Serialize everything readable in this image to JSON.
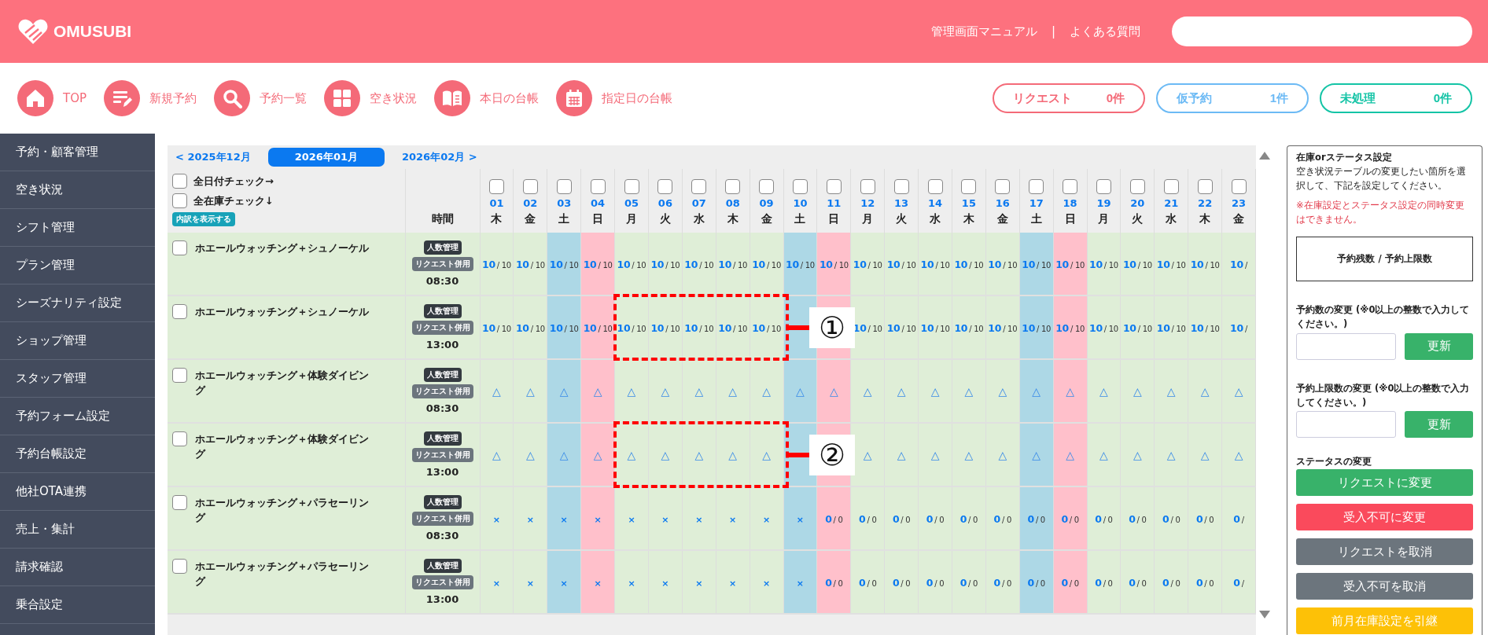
{
  "header": {
    "brand": "OMUSUBI",
    "links": [
      {
        "label": "管理画面マニュアル"
      },
      {
        "label": "よくある質問"
      }
    ],
    "link_separator": "|"
  },
  "nav": [
    {
      "label": "TOP"
    },
    {
      "label": "新規予約"
    },
    {
      "label": "予約一覧"
    },
    {
      "label": "空き状況"
    },
    {
      "label": "本日の台帳"
    },
    {
      "label": "指定日の台帳"
    }
  ],
  "counters": [
    {
      "label": "リクエスト",
      "count": "0件",
      "kind": "request"
    },
    {
      "label": "仮予約",
      "count": "1件",
      "kind": "provisional"
    },
    {
      "label": "未処理",
      "count": "0件",
      "kind": "unprocessed"
    }
  ],
  "sidebar": {
    "items": [
      {
        "label": "予約・顧客管理",
        "selected": false
      },
      {
        "label": "空き状況",
        "selected": false
      },
      {
        "label": "シフト管理",
        "selected": false
      },
      {
        "label": "プラン管理",
        "selected": false
      },
      {
        "label": "シーズナリティ設定",
        "selected": false
      },
      {
        "label": "ショップ管理",
        "selected": false
      },
      {
        "label": "スタッフ管理",
        "selected": false
      },
      {
        "label": "予約フォーム設定",
        "selected": false
      },
      {
        "label": "予約台帳設定",
        "selected": false
      },
      {
        "label": "他社OTA連携",
        "selected": false
      },
      {
        "label": "売上・集計",
        "selected": false
      },
      {
        "label": "請求確認",
        "selected": false
      },
      {
        "label": "乗合設定",
        "selected": false
      }
    ]
  },
  "availability": {
    "months": [
      {
        "label": "< 2025年12月",
        "selected": false
      },
      {
        "label": "2026年01月",
        "selected": true
      },
      {
        "label": "2026年02月 >",
        "selected": false
      }
    ],
    "check_all_dates": {
      "label": "全日付チェック→",
      "checked": false
    },
    "check_all_stock": {
      "label": "全在庫チェック↓",
      "checked": false
    },
    "breakdown_button": "内訳を表示する",
    "time_heading": "時間",
    "days": [
      {
        "date": "01",
        "weekday": "木",
        "kind": "weekday",
        "checked": false
      },
      {
        "date": "02",
        "weekday": "金",
        "kind": "weekday",
        "checked": false
      },
      {
        "date": "03",
        "weekday": "土",
        "kind": "saturday",
        "checked": false
      },
      {
        "date": "04",
        "weekday": "日",
        "kind": "sunday",
        "checked": false
      },
      {
        "date": "05",
        "weekday": "月",
        "kind": "weekday",
        "checked": false
      },
      {
        "date": "06",
        "weekday": "火",
        "kind": "weekday",
        "checked": false
      },
      {
        "date": "07",
        "weekday": "水",
        "kind": "weekday",
        "checked": false
      },
      {
        "date": "08",
        "weekday": "木",
        "kind": "weekday",
        "checked": false
      },
      {
        "date": "09",
        "weekday": "金",
        "kind": "weekday",
        "checked": false
      },
      {
        "date": "10",
        "weekday": "土",
        "kind": "saturday",
        "checked": false
      },
      {
        "date": "11",
        "weekday": "日",
        "kind": "sunday",
        "checked": false
      },
      {
        "date": "12",
        "weekday": "月",
        "kind": "weekday",
        "checked": false
      },
      {
        "date": "13",
        "weekday": "火",
        "kind": "weekday",
        "checked": false
      },
      {
        "date": "14",
        "weekday": "水",
        "kind": "weekday",
        "checked": false
      },
      {
        "date": "15",
        "weekday": "木",
        "kind": "weekday",
        "checked": false
      },
      {
        "date": "16",
        "weekday": "金",
        "kind": "weekday",
        "checked": false
      },
      {
        "date": "17",
        "weekday": "土",
        "kind": "saturday",
        "checked": false
      },
      {
        "date": "18",
        "weekday": "日",
        "kind": "sunday",
        "checked": false
      },
      {
        "date": "19",
        "weekday": "月",
        "kind": "weekday",
        "checked": false
      },
      {
        "date": "20",
        "weekday": "火",
        "kind": "weekday",
        "checked": false
      },
      {
        "date": "21",
        "weekday": "水",
        "kind": "weekday",
        "checked": false
      },
      {
        "date": "22",
        "weekday": "木",
        "kind": "weekday",
        "checked": false
      },
      {
        "date": "23",
        "weekday": "金",
        "kind": "weekday",
        "checked": false
      }
    ],
    "rows": [
      {
        "name": "ホエールウォッチング＋シュノーケル",
        "checked": false,
        "tags": [
          {
            "label": "人数管理",
            "kind": "dark"
          },
          {
            "label": "リクエスト併用",
            "kind": "grey"
          }
        ],
        "time": "08:30",
        "cells": [
          {
            "kind": "count",
            "value": "10",
            "rest": "/ 10"
          },
          {
            "kind": "count",
            "value": "10",
            "rest": "/ 10"
          },
          {
            "kind": "count",
            "value": "10",
            "rest": "/ 10"
          },
          {
            "kind": "count",
            "value": "10",
            "rest": "/ 10"
          },
          {
            "kind": "count",
            "value": "10",
            "rest": "/ 10"
          },
          {
            "kind": "count",
            "value": "10",
            "rest": "/ 10"
          },
          {
            "kind": "count",
            "value": "10",
            "rest": "/ 10"
          },
          {
            "kind": "count",
            "value": "10",
            "rest": "/ 10"
          },
          {
            "kind": "count",
            "value": "10",
            "rest": "/ 10"
          },
          {
            "kind": "count",
            "value": "10",
            "rest": "/ 10"
          },
          {
            "kind": "count",
            "value": "10",
            "rest": "/ 10"
          },
          {
            "kind": "count",
            "value": "10",
            "rest": "/ 10"
          },
          {
            "kind": "count",
            "value": "10",
            "rest": "/ 10"
          },
          {
            "kind": "count",
            "value": "10",
            "rest": "/ 10"
          },
          {
            "kind": "count",
            "value": "10",
            "rest": "/ 10"
          },
          {
            "kind": "count",
            "value": "10",
            "rest": "/ 10"
          },
          {
            "kind": "count",
            "value": "10",
            "rest": "/ 10"
          },
          {
            "kind": "count",
            "value": "10",
            "rest": "/ 10"
          },
          {
            "kind": "count",
            "value": "10",
            "rest": "/ 10"
          },
          {
            "kind": "count",
            "value": "10",
            "rest": "/ 10"
          },
          {
            "kind": "count",
            "value": "10",
            "rest": "/ 10"
          },
          {
            "kind": "count",
            "value": "10",
            "rest": "/ 10"
          },
          {
            "kind": "count",
            "value": "10",
            "rest": "/"
          }
        ]
      },
      {
        "name": "ホエールウォッチング＋シュノーケル",
        "checked": false,
        "tags": [
          {
            "label": "人数管理",
            "kind": "dark"
          },
          {
            "label": "リクエスト併用",
            "kind": "grey"
          }
        ],
        "time": "13:00",
        "cells": [
          {
            "kind": "count",
            "value": "10",
            "rest": "/ 10"
          },
          {
            "kind": "count",
            "value": "10",
            "rest": "/ 10"
          },
          {
            "kind": "count",
            "value": "10",
            "rest": "/ 10"
          },
          {
            "kind": "count",
            "value": "10",
            "rest": "/ 10"
          },
          {
            "kind": "count",
            "value": "10",
            "rest": "/ 10",
            "framed": true
          },
          {
            "kind": "count",
            "value": "10",
            "rest": "/ 10",
            "framed": true
          },
          {
            "kind": "count",
            "value": "10",
            "rest": "/ 10",
            "framed": true
          },
          {
            "kind": "count",
            "value": "10",
            "rest": "/ 10",
            "framed": true
          },
          {
            "kind": "count",
            "value": "10",
            "rest": "/ 10",
            "framed": true
          },
          {
            "kind": "covered"
          },
          {
            "kind": "covered"
          },
          {
            "kind": "count",
            "value": "10",
            "rest": "/ 10"
          },
          {
            "kind": "count",
            "value": "10",
            "rest": "/ 10"
          },
          {
            "kind": "count",
            "value": "10",
            "rest": "/ 10"
          },
          {
            "kind": "count",
            "value": "10",
            "rest": "/ 10"
          },
          {
            "kind": "count",
            "value": "10",
            "rest": "/ 10"
          },
          {
            "kind": "count",
            "value": "10",
            "rest": "/ 10"
          },
          {
            "kind": "count",
            "value": "10",
            "rest": "/ 10"
          },
          {
            "kind": "count",
            "value": "10",
            "rest": "/ 10"
          },
          {
            "kind": "count",
            "value": "10",
            "rest": "/ 10"
          },
          {
            "kind": "count",
            "value": "10",
            "rest": "/ 10"
          },
          {
            "kind": "count",
            "value": "10",
            "rest": "/ 10"
          },
          {
            "kind": "count",
            "value": "10",
            "rest": "/"
          }
        ]
      },
      {
        "name": "ホエールウォッチング＋体験ダイビング",
        "checked": false,
        "tags": [
          {
            "label": "人数管理",
            "kind": "dark"
          },
          {
            "label": "リクエスト併用",
            "kind": "grey"
          }
        ],
        "time": "08:30",
        "cells": [
          {
            "kind": "mark",
            "text": "△"
          },
          {
            "kind": "mark",
            "text": "△"
          },
          {
            "kind": "mark",
            "text": "△"
          },
          {
            "kind": "mark",
            "text": "△"
          },
          {
            "kind": "mark",
            "text": "△"
          },
          {
            "kind": "mark",
            "text": "△"
          },
          {
            "kind": "mark",
            "text": "△"
          },
          {
            "kind": "mark",
            "text": "△"
          },
          {
            "kind": "mark",
            "text": "△"
          },
          {
            "kind": "mark",
            "text": "△"
          },
          {
            "kind": "mark",
            "text": "△"
          },
          {
            "kind": "mark",
            "text": "△"
          },
          {
            "kind": "mark",
            "text": "△"
          },
          {
            "kind": "mark",
            "text": "△"
          },
          {
            "kind": "mark",
            "text": "△"
          },
          {
            "kind": "mark",
            "text": "△"
          },
          {
            "kind": "mark",
            "text": "△"
          },
          {
            "kind": "mark",
            "text": "△"
          },
          {
            "kind": "mark",
            "text": "△"
          },
          {
            "kind": "mark",
            "text": "△"
          },
          {
            "kind": "mark",
            "text": "△"
          },
          {
            "kind": "mark",
            "text": "△"
          },
          {
            "kind": "mark",
            "text": "△"
          }
        ]
      },
      {
        "name": "ホエールウォッチング＋体験ダイビング",
        "checked": false,
        "tags": [
          {
            "label": "人数管理",
            "kind": "dark"
          },
          {
            "label": "リクエスト併用",
            "kind": "grey"
          }
        ],
        "time": "13:00",
        "cells": [
          {
            "kind": "mark",
            "text": "△"
          },
          {
            "kind": "mark",
            "text": "△"
          },
          {
            "kind": "mark",
            "text": "△"
          },
          {
            "kind": "mark",
            "text": "△"
          },
          {
            "kind": "mark",
            "text": "△",
            "framed": true
          },
          {
            "kind": "mark",
            "text": "△",
            "framed": true
          },
          {
            "kind": "mark",
            "text": "△",
            "framed": true
          },
          {
            "kind": "mark",
            "text": "△",
            "framed": true
          },
          {
            "kind": "mark",
            "text": "△",
            "framed": true
          },
          {
            "kind": "covered"
          },
          {
            "kind": "covered"
          },
          {
            "kind": "mark",
            "text": "△"
          },
          {
            "kind": "mark",
            "text": "△"
          },
          {
            "kind": "mark",
            "text": "△"
          },
          {
            "kind": "mark",
            "text": "△"
          },
          {
            "kind": "mark",
            "text": "△"
          },
          {
            "kind": "mark",
            "text": "△"
          },
          {
            "kind": "mark",
            "text": "△"
          },
          {
            "kind": "mark",
            "text": "△"
          },
          {
            "kind": "mark",
            "text": "△"
          },
          {
            "kind": "mark",
            "text": "△"
          },
          {
            "kind": "mark",
            "text": "△"
          },
          {
            "kind": "mark",
            "text": "△"
          }
        ]
      },
      {
        "name": "ホエールウォッチング＋パラセーリング",
        "checked": false,
        "tags": [
          {
            "label": "人数管理",
            "kind": "dark"
          },
          {
            "label": "リクエスト併用",
            "kind": "grey"
          }
        ],
        "time": "08:30",
        "cells": [
          {
            "kind": "cross",
            "text": "×"
          },
          {
            "kind": "cross",
            "text": "×"
          },
          {
            "kind": "cross",
            "text": "×"
          },
          {
            "kind": "cross",
            "text": "×"
          },
          {
            "kind": "cross",
            "text": "×"
          },
          {
            "kind": "cross",
            "text": "×"
          },
          {
            "kind": "cross",
            "text": "×"
          },
          {
            "kind": "cross",
            "text": "×"
          },
          {
            "kind": "cross",
            "text": "×"
          },
          {
            "kind": "cross",
            "text": "×"
          },
          {
            "kind": "count",
            "value": "0",
            "rest": "/ 0"
          },
          {
            "kind": "count",
            "value": "0",
            "rest": "/ 0"
          },
          {
            "kind": "count",
            "value": "0",
            "rest": "/ 0"
          },
          {
            "kind": "count",
            "value": "0",
            "rest": "/ 0"
          },
          {
            "kind": "count",
            "value": "0",
            "rest": "/ 0"
          },
          {
            "kind": "count",
            "value": "0",
            "rest": "/ 0"
          },
          {
            "kind": "count",
            "value": "0",
            "rest": "/ 0"
          },
          {
            "kind": "count",
            "value": "0",
            "rest": "/ 0"
          },
          {
            "kind": "count",
            "value": "0",
            "rest": "/ 0"
          },
          {
            "kind": "count",
            "value": "0",
            "rest": "/ 0"
          },
          {
            "kind": "count",
            "value": "0",
            "rest": "/ 0"
          },
          {
            "kind": "count",
            "value": "0",
            "rest": "/ 0"
          },
          {
            "kind": "count",
            "value": "0",
            "rest": "/"
          }
        ]
      },
      {
        "name": "ホエールウォッチング＋パラセーリング",
        "checked": false,
        "tags": [
          {
            "label": "人数管理",
            "kind": "dark"
          },
          {
            "label": "リクエスト併用",
            "kind": "grey"
          }
        ],
        "time": "13:00",
        "cells": [
          {
            "kind": "cross",
            "text": "×"
          },
          {
            "kind": "cross",
            "text": "×"
          },
          {
            "kind": "cross",
            "text": "×"
          },
          {
            "kind": "cross",
            "text": "×"
          },
          {
            "kind": "cross",
            "text": "×"
          },
          {
            "kind": "cross",
            "text": "×"
          },
          {
            "kind": "cross",
            "text": "×"
          },
          {
            "kind": "cross",
            "text": "×"
          },
          {
            "kind": "cross",
            "text": "×"
          },
          {
            "kind": "cross",
            "text": "×"
          },
          {
            "kind": "count",
            "value": "0",
            "rest": "/ 0"
          },
          {
            "kind": "count",
            "value": "0",
            "rest": "/ 0"
          },
          {
            "kind": "count",
            "value": "0",
            "rest": "/ 0"
          },
          {
            "kind": "count",
            "value": "0",
            "rest": "/ 0"
          },
          {
            "kind": "count",
            "value": "0",
            "rest": "/ 0"
          },
          {
            "kind": "count",
            "value": "0",
            "rest": "/ 0"
          },
          {
            "kind": "count",
            "value": "0",
            "rest": "/ 0"
          },
          {
            "kind": "count",
            "value": "0",
            "rest": "/ 0"
          },
          {
            "kind": "count",
            "value": "0",
            "rest": "/ 0"
          },
          {
            "kind": "count",
            "value": "0",
            "rest": "/ 0"
          },
          {
            "kind": "count",
            "value": "0",
            "rest": "/ 0"
          },
          {
            "kind": "count",
            "value": "0",
            "rest": "/ 0"
          },
          {
            "kind": "count",
            "value": "0",
            "rest": "/"
          }
        ]
      }
    ],
    "callouts": [
      {
        "label": "①"
      },
      {
        "label": "②"
      }
    ]
  },
  "settings": {
    "title": "在庫orステータス設定",
    "description": "空き状況テーブルの変更したい箇所を選択して、下記を設定してください。",
    "warning": "※在庫設定とステータス設定の同時変更はできません。",
    "legend": "予約残数 / 予約上限数",
    "forms": [
      {
        "label": "予約数の変更 (※0以上の整数で入力してください。)",
        "button": "更新"
      },
      {
        "label": "予約上限数の変更 (※0以上の整数で入力してください。)",
        "button": "更新"
      }
    ],
    "status_heading": "ステータスの変更",
    "actions": [
      {
        "label": "リクエストに変更",
        "kind": "success"
      },
      {
        "label": "受入不可に変更",
        "kind": "danger"
      },
      {
        "label": "リクエストを取消",
        "kind": "secondary"
      },
      {
        "label": "受入不可を取消",
        "kind": "secondary"
      },
      {
        "label": "前月在庫設定を引継",
        "kind": "warning"
      }
    ]
  }
}
